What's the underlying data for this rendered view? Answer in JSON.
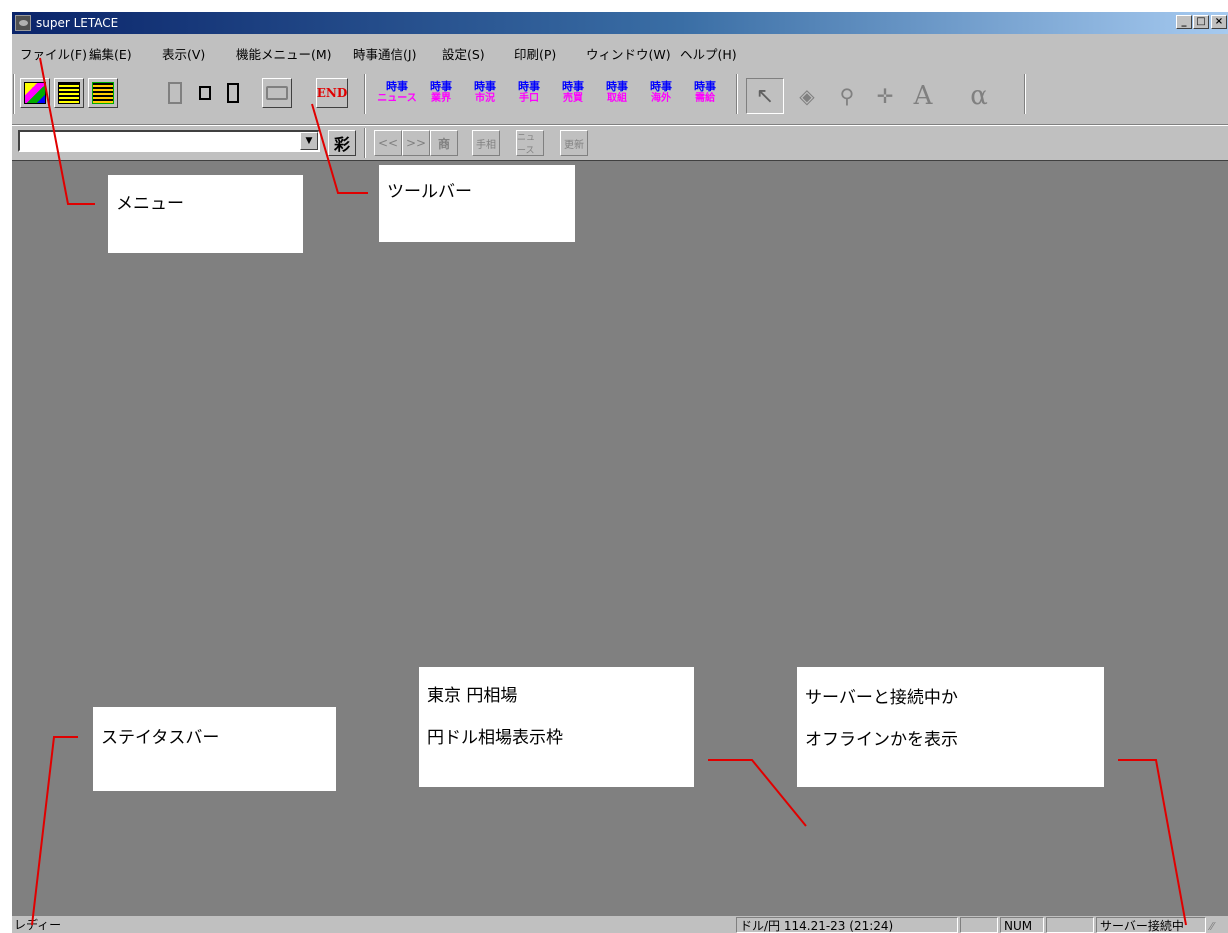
{
  "window": {
    "title": "super LETACE"
  },
  "caption_buttons": {
    "minimize": "_",
    "maximize": "□",
    "close": "×"
  },
  "menu": [
    "ファイル(F)",
    "編集(E)",
    "表示(V)",
    "機能メニュー(M)",
    "時事通信(J)",
    "設定(S)",
    "印刷(P)",
    "ウィンドウ(W)",
    "ヘルプ(H)"
  ],
  "toolbar": {
    "end_label": "END",
    "jiji_buttons": [
      {
        "top": "時事",
        "bottom": "ニュース"
      },
      {
        "top": "時事",
        "bottom": "業界"
      },
      {
        "top": "時事",
        "bottom": "市況"
      },
      {
        "top": "時事",
        "bottom": "手口"
      },
      {
        "top": "時事",
        "bottom": "売買"
      },
      {
        "top": "時事",
        "bottom": "取組"
      },
      {
        "top": "時事",
        "bottom": "海外"
      },
      {
        "top": "時事",
        "bottom": "需給"
      }
    ],
    "font_button": "A",
    "alpha_button": "α"
  },
  "toolbar2": {
    "combo_value": "",
    "buttons": [
      "<<",
      ">>",
      "商",
      "手相",
      "ニュース",
      "更新"
    ]
  },
  "callouts": {
    "menu": "メニュー",
    "toolbar": "ツールバー",
    "statusbar": "ステイタスバー",
    "rate_line1": "東京 円相場",
    "rate_line2": "円ドル相場表示枠",
    "server_line1": "サーバーと接続中か",
    "server_line2": "オフラインかを表示"
  },
  "status": {
    "ready": "レディー",
    "rate": "ドル/円  114.21-23  (21:24)",
    "num": "NUM",
    "connection": "サーバー接続中"
  }
}
